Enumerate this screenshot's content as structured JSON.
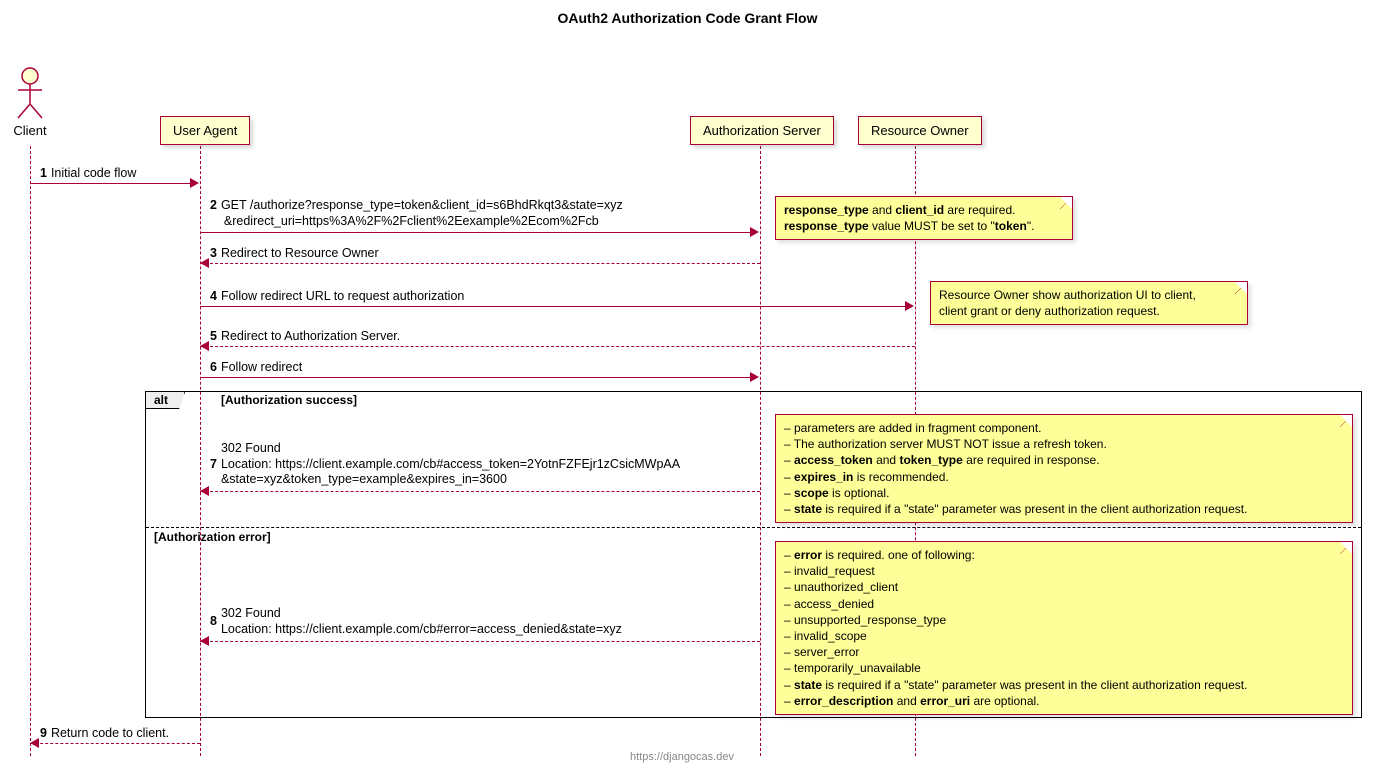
{
  "title": "OAuth2 Authorization Code Grant Flow",
  "participants": {
    "client": "Client",
    "user_agent": "User Agent",
    "auth_server": "Authorization Server",
    "resource_owner": "Resource Owner"
  },
  "messages": {
    "m1": "Initial code flow",
    "m2_l1": "GET /authorize?response_type=token&client_id=s6BhdRkqt3&state=xyz",
    "m2_l2": "        &redirect_uri=https%3A%2F%2Fclient%2Eexample%2Ecom%2Fcb",
    "m3": "Redirect to Resource Owner",
    "m4": "Follow redirect URL to request authorization",
    "m5": "Redirect to Authorization Server.",
    "m6": "Follow redirect",
    "m7_l1": "302 Found",
    "m7_l2": "Location: https://client.example.com/cb#access_token=2YotnFZFEjr1zCsicMWpAA",
    "m7_l3": "        &state=xyz&token_type=example&expires_in=3600",
    "m8_l1": "302 Found",
    "m8_l2": "Location: https://client.example.com/cb#error=access_denied&state=xyz",
    "m9": "Return code to client."
  },
  "notes": {
    "n1_l1a": "response_type",
    "n1_l1b": " and ",
    "n1_l1c": "client_id",
    "n1_l1d": " are required.",
    "n1_l2a": "response_type",
    "n1_l2b": " value MUST be set to \"",
    "n1_l2c": "token",
    "n1_l2d": "\".",
    "n2_l1": "Resource Owner show authorization UI to client,",
    "n2_l2": "client grant or deny authorization request.",
    "n3_l1": "– parameters are added in fragment component.",
    "n3_l2": "– The authorization server MUST NOT issue a refresh token.",
    "n3_l3a": "– ",
    "n3_l3b": "access_token",
    "n3_l3c": " and ",
    "n3_l3d": "token_type",
    "n3_l3e": " are required in response.",
    "n3_l4a": "– ",
    "n3_l4b": "expires_in",
    "n3_l4c": " is recommended.",
    "n3_l5a": "– ",
    "n3_l5b": "scope",
    "n3_l5c": " is optional.",
    "n3_l6a": "– ",
    "n3_l6b": "state",
    "n3_l6c": " is required if a \"state\" parameter was present in the client authorization request.",
    "n4_l1a": "– ",
    "n4_l1b": "error",
    "n4_l1c": " is required. one of following:",
    "n4_l2": "  – invalid_request",
    "n4_l3": "  – unauthorized_client",
    "n4_l4": "  – access_denied",
    "n4_l5": "  – unsupported_response_type",
    "n4_l6": "  – invalid_scope",
    "n4_l7": "  – server_error",
    "n4_l8": "  – temporarily_unavailable",
    "n4_l9a": "– ",
    "n4_l9b": "state",
    "n4_l9c": " is required if a \"state\" parameter was present in the client authorization request.",
    "n4_l10a": "– ",
    "n4_l10b": "error_description",
    "n4_l10c": " and ",
    "n4_l10d": "error_uri",
    "n4_l10e": " are optional."
  },
  "alt": {
    "label": "alt",
    "cond1": "[Authorization success]",
    "cond2": "[Authorization error]"
  },
  "footer": "https://djangocas.dev"
}
